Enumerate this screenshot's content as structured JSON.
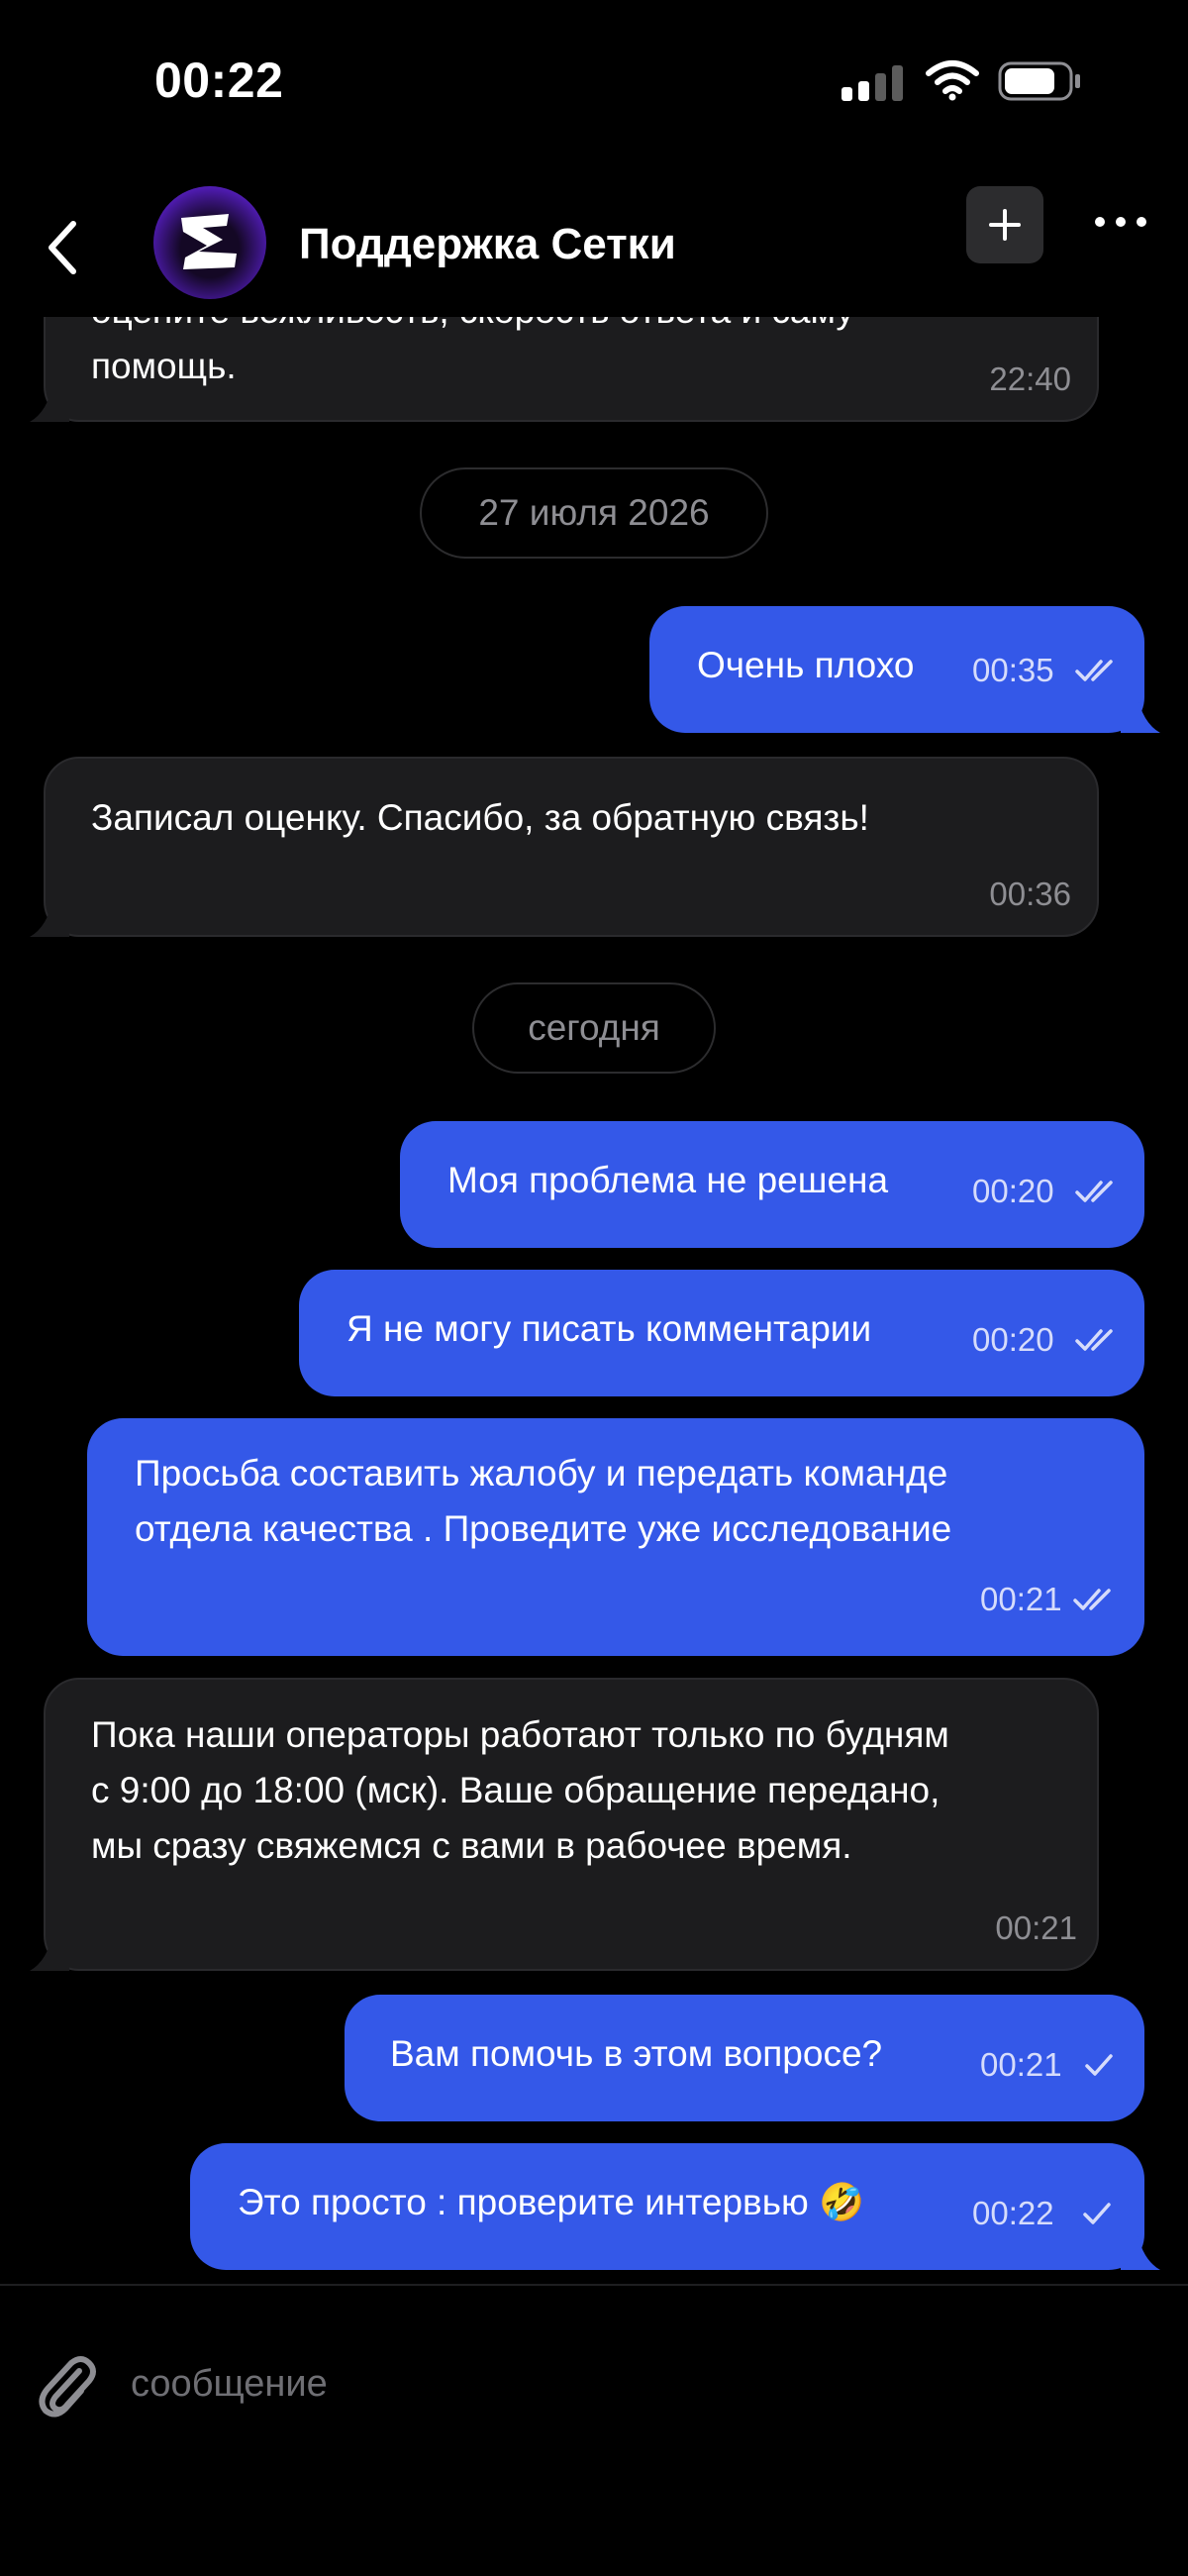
{
  "status_bar": {
    "time": "00:22",
    "signal_icon": "cellular-signal-icon",
    "wifi_icon": "wifi-icon",
    "battery_icon": "battery-icon"
  },
  "header": {
    "title": "Поддержка Сетки",
    "back_icon": "chevron-left-icon",
    "avatar_icon": "setka-logo",
    "new_chat_icon": "plus-icon",
    "more_icon": "ellipsis-icon"
  },
  "messages": [
    {
      "type": "in",
      "text_lines": [
        "оцените вежливость, скорость ответа и саму",
        "помощь."
      ],
      "time": "22:40"
    },
    {
      "type": "date",
      "text": "27 июля 2026"
    },
    {
      "type": "out",
      "text_lines": [
        "Очень плохо"
      ],
      "time": "00:35",
      "status": "read"
    },
    {
      "type": "in",
      "text_lines": [
        "Записал оценку. Спасибо, за обратную связь!"
      ],
      "time": "00:36"
    },
    {
      "type": "date",
      "text": "сегодня"
    },
    {
      "type": "out",
      "text_lines": [
        "Моя проблема не решена"
      ],
      "time": "00:20",
      "status": "read"
    },
    {
      "type": "out",
      "text_lines": [
        "Я не могу писать комментарии"
      ],
      "time": "00:20",
      "status": "read"
    },
    {
      "type": "out",
      "text_lines": [
        "Просьба составить жалобу и передать команде",
        "отдела качества . Проведите уже исследование"
      ],
      "time": "00:21",
      "status": "read"
    },
    {
      "type": "in",
      "text_lines": [
        "Пока наши операторы работают только по будням",
        "с 9:00 до 18:00 (мск). Ваше обращение передано,",
        "мы сразу свяжемся с вами в рабочее время."
      ],
      "time": "00:21"
    },
    {
      "type": "out",
      "text_lines": [
        "Вам помочь в этом вопросе?"
      ],
      "time": "00:21",
      "status": "sent"
    },
    {
      "type": "out",
      "text_lines": [
        "Это просто : проверите интервью 🤣"
      ],
      "time": "00:22",
      "status": "sent"
    }
  ],
  "composer": {
    "placeholder": "сообщение",
    "value": "",
    "attach_icon": "paperclip-icon"
  },
  "colors": {
    "background": "#000000",
    "incoming_bubble": "#1c1c1e",
    "outgoing_bubble": "#3458e8",
    "muted_text": "#8e8e93"
  }
}
